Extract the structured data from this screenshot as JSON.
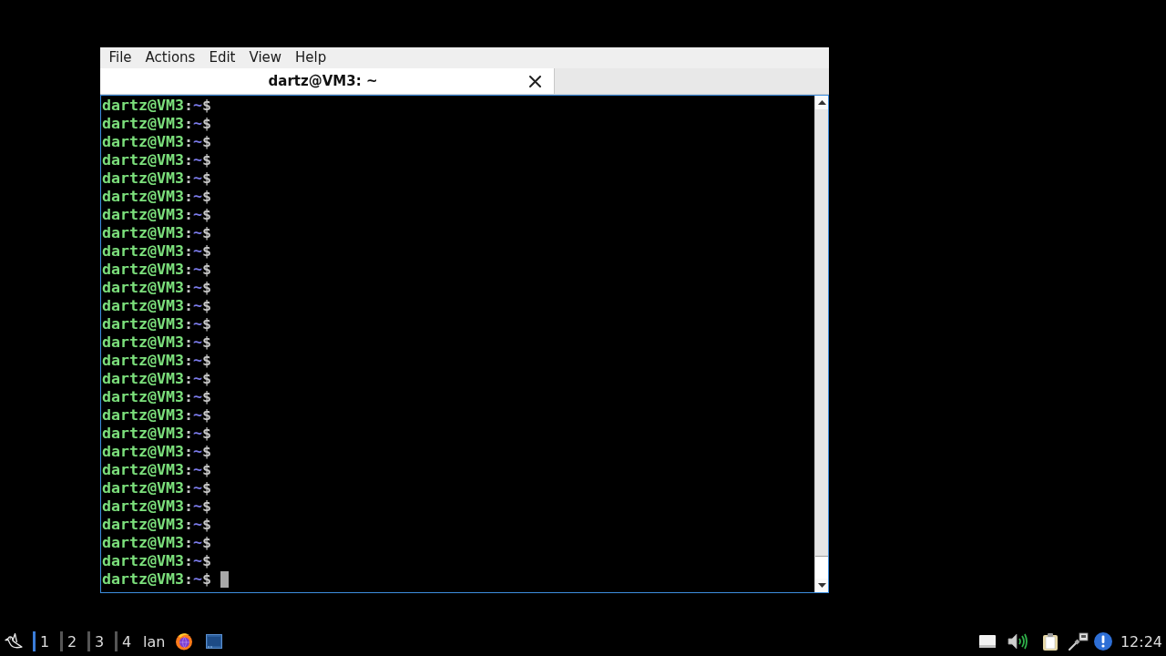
{
  "window": {
    "menu": [
      "File",
      "Actions",
      "Edit",
      "View",
      "Help"
    ],
    "tabs": [
      {
        "title": "dartz@VM3: ~",
        "selected": true
      }
    ]
  },
  "terminal": {
    "lines": [
      {
        "user_host": "dartz@VM3",
        "separator": ":",
        "path": "~",
        "symbol": "$",
        "cursor": false
      },
      {
        "user_host": "dartz@VM3",
        "separator": ":",
        "path": "~",
        "symbol": "$",
        "cursor": false
      },
      {
        "user_host": "dartz@VM3",
        "separator": ":",
        "path": "~",
        "symbol": "$",
        "cursor": false
      },
      {
        "user_host": "dartz@VM3",
        "separator": ":",
        "path": "~",
        "symbol": "$",
        "cursor": false
      },
      {
        "user_host": "dartz@VM3",
        "separator": ":",
        "path": "~",
        "symbol": "$",
        "cursor": false
      },
      {
        "user_host": "dartz@VM3",
        "separator": ":",
        "path": "~",
        "symbol": "$",
        "cursor": false
      },
      {
        "user_host": "dartz@VM3",
        "separator": ":",
        "path": "~",
        "symbol": "$",
        "cursor": false
      },
      {
        "user_host": "dartz@VM3",
        "separator": ":",
        "path": "~",
        "symbol": "$",
        "cursor": false
      },
      {
        "user_host": "dartz@VM3",
        "separator": ":",
        "path": "~",
        "symbol": "$",
        "cursor": false
      },
      {
        "user_host": "dartz@VM3",
        "separator": ":",
        "path": "~",
        "symbol": "$",
        "cursor": false
      },
      {
        "user_host": "dartz@VM3",
        "separator": ":",
        "path": "~",
        "symbol": "$",
        "cursor": false
      },
      {
        "user_host": "dartz@VM3",
        "separator": ":",
        "path": "~",
        "symbol": "$",
        "cursor": false
      },
      {
        "user_host": "dartz@VM3",
        "separator": ":",
        "path": "~",
        "symbol": "$",
        "cursor": false
      },
      {
        "user_host": "dartz@VM3",
        "separator": ":",
        "path": "~",
        "symbol": "$",
        "cursor": false
      },
      {
        "user_host": "dartz@VM3",
        "separator": ":",
        "path": "~",
        "symbol": "$",
        "cursor": false
      },
      {
        "user_host": "dartz@VM3",
        "separator": ":",
        "path": "~",
        "symbol": "$",
        "cursor": false
      },
      {
        "user_host": "dartz@VM3",
        "separator": ":",
        "path": "~",
        "symbol": "$",
        "cursor": false
      },
      {
        "user_host": "dartz@VM3",
        "separator": ":",
        "path": "~",
        "symbol": "$",
        "cursor": false
      },
      {
        "user_host": "dartz@VM3",
        "separator": ":",
        "path": "~",
        "symbol": "$",
        "cursor": false
      },
      {
        "user_host": "dartz@VM3",
        "separator": ":",
        "path": "~",
        "symbol": "$",
        "cursor": false
      },
      {
        "user_host": "dartz@VM3",
        "separator": ":",
        "path": "~",
        "symbol": "$",
        "cursor": false
      },
      {
        "user_host": "dartz@VM3",
        "separator": ":",
        "path": "~",
        "symbol": "$",
        "cursor": false
      },
      {
        "user_host": "dartz@VM3",
        "separator": ":",
        "path": "~",
        "symbol": "$",
        "cursor": false
      },
      {
        "user_host": "dartz@VM3",
        "separator": ":",
        "path": "~",
        "symbol": "$",
        "cursor": false
      },
      {
        "user_host": "dartz@VM3",
        "separator": ":",
        "path": "~",
        "symbol": "$",
        "cursor": false
      },
      {
        "user_host": "dartz@VM3",
        "separator": ":",
        "path": "~",
        "symbol": "$",
        "cursor": false
      },
      {
        "user_host": "dartz@VM3",
        "separator": ":",
        "path": "~",
        "symbol": "$",
        "cursor": true
      }
    ]
  },
  "taskbar": {
    "desktops": [
      {
        "label": "1",
        "selected": true
      },
      {
        "label": "2",
        "selected": false
      },
      {
        "label": "3",
        "selected": false
      },
      {
        "label": "4",
        "selected": false
      }
    ],
    "window_button": "lan",
    "clock": "12:24"
  }
}
